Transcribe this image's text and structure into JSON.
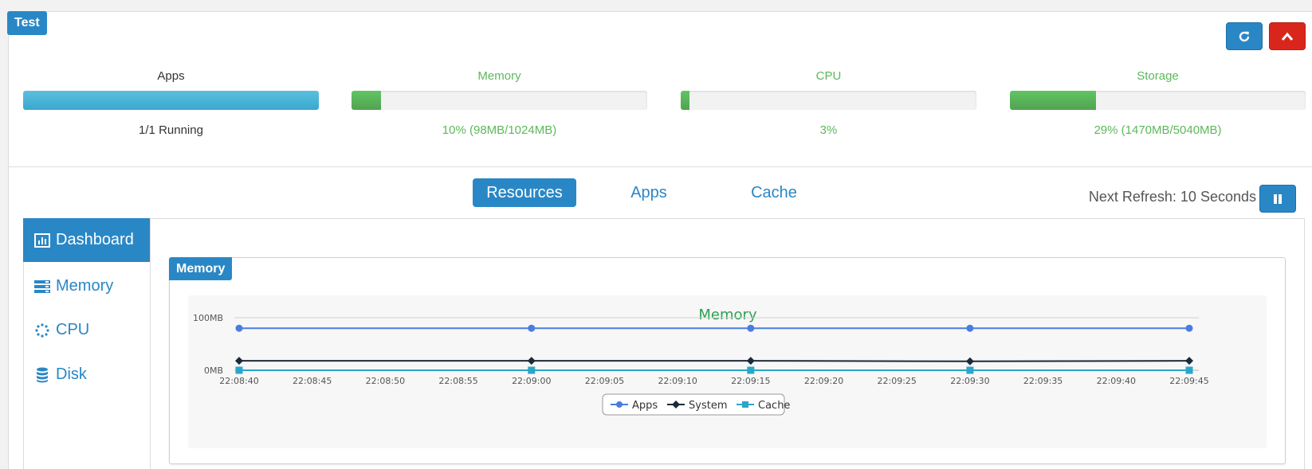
{
  "panel": {
    "title": "Test"
  },
  "stats": [
    {
      "label": "Apps",
      "value": "1/1 Running",
      "fill_fraction": 1.0,
      "color": "#5bc0de"
    },
    {
      "label": "Memory",
      "value": "10% (98MB/1024MB)",
      "fill_fraction": 0.1,
      "color": "#62c462"
    },
    {
      "label": "CPU",
      "value": "3%",
      "fill_fraction": 0.03,
      "color": "#62c462"
    },
    {
      "label": "Storage",
      "value": "29% (1470MB/5040MB)",
      "fill_fraction": 0.29,
      "color": "#62c462"
    }
  ],
  "tabs": [
    {
      "label": "Resources",
      "active": true
    },
    {
      "label": "Apps",
      "active": false
    },
    {
      "label": "Cache",
      "active": false
    }
  ],
  "refresh": {
    "text": "Next Refresh: 10 Seconds"
  },
  "sidebar": {
    "items": [
      {
        "label": "Dashboard",
        "icon": "bar-chart-icon",
        "active": true
      },
      {
        "label": "Memory",
        "icon": "server-icon",
        "active": false
      },
      {
        "label": "CPU",
        "icon": "spinner-icon",
        "active": false
      },
      {
        "label": "Disk",
        "icon": "database-icon",
        "active": false
      }
    ]
  },
  "memory_panel": {
    "title": "Memory"
  },
  "colors": {
    "accent": "#2a87c6",
    "danger": "#d9261c",
    "success": "#5cb85c",
    "info": "#5bc0de"
  },
  "chart_data": {
    "type": "line",
    "title": "Memory",
    "xlabel": "",
    "ylabel": "",
    "x": [
      "22:08:40",
      "22:08:45",
      "22:08:50",
      "22:08:55",
      "22:09:00",
      "22:09:05",
      "22:09:10",
      "22:09:15",
      "22:09:20",
      "22:09:25",
      "22:09:30",
      "22:09:35",
      "22:09:40",
      "22:09:45"
    ],
    "y_tick_labels": [
      "0MB",
      "100MB"
    ],
    "ylim": [
      0,
      100
    ],
    "grid": true,
    "legend_position": "bottom",
    "series": [
      {
        "name": "Apps",
        "color": "#4a7de0",
        "marker": "circle",
        "points": [
          [
            "22:08:40",
            80
          ],
          [
            "22:09:00",
            80
          ],
          [
            "22:09:15",
            80
          ],
          [
            "22:09:30",
            80
          ],
          [
            "22:09:45",
            80
          ]
        ]
      },
      {
        "name": "System",
        "color": "#1d2a3a",
        "marker": "diamond",
        "points": [
          [
            "22:08:40",
            18
          ],
          [
            "22:09:00",
            18
          ],
          [
            "22:09:15",
            18
          ],
          [
            "22:09:30",
            17
          ],
          [
            "22:09:45",
            18
          ]
        ]
      },
      {
        "name": "Cache",
        "color": "#2aa6c9",
        "marker": "square",
        "points": [
          [
            "22:08:40",
            0
          ],
          [
            "22:09:00",
            0
          ],
          [
            "22:09:15",
            0
          ],
          [
            "22:09:30",
            0
          ],
          [
            "22:09:45",
            0
          ]
        ]
      }
    ]
  }
}
